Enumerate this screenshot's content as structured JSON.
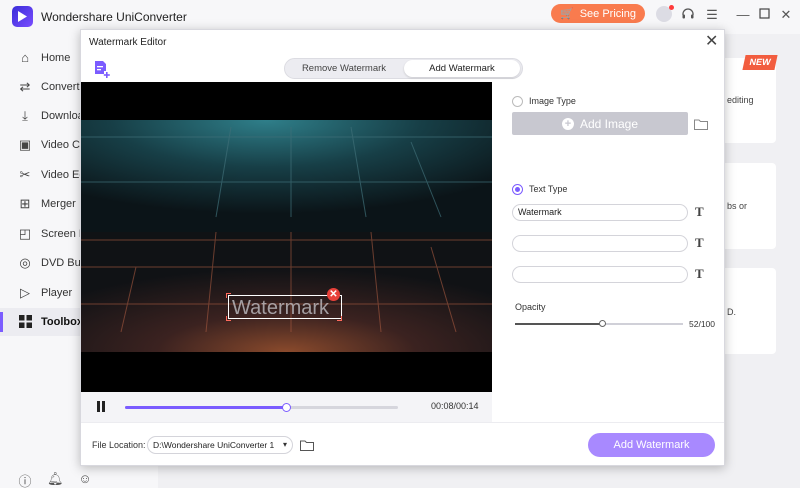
{
  "app": {
    "title": "Wondershare UniConverter",
    "see_pricing": "See Pricing",
    "icons": [
      "user-icon",
      "headset-icon",
      "menu-icon",
      "minimize-icon",
      "maximize-icon",
      "close-icon"
    ]
  },
  "sidebar": {
    "items": [
      {
        "label": "Home",
        "icon": "home-icon"
      },
      {
        "label": "Converter",
        "icon": "converter-icon"
      },
      {
        "label": "Downloader",
        "icon": "download-icon"
      },
      {
        "label": "Video Compressor",
        "icon": "compress-icon"
      },
      {
        "label": "Video Editor",
        "icon": "scissors-icon"
      },
      {
        "label": "Merger",
        "icon": "merge-icon"
      },
      {
        "label": "Screen Recorder",
        "icon": "record-icon"
      },
      {
        "label": "DVD Burner",
        "icon": "disc-icon"
      },
      {
        "label": "Player",
        "icon": "play-icon"
      },
      {
        "label": "Toolbox",
        "icon": "grid-icon",
        "active": true
      }
    ],
    "bottom_icons": [
      "help-icon",
      "bell-icon",
      "feedback-icon"
    ]
  },
  "background": {
    "new_badge": "NEW",
    "snippets": [
      "editing",
      "bs or",
      "D."
    ]
  },
  "modal": {
    "title": "Watermark Editor",
    "tabs": [
      {
        "label": "Remove Watermark",
        "active": false
      },
      {
        "label": "Add Watermark",
        "active": true
      }
    ],
    "preview": {
      "watermark_text": "Watermark",
      "time": "00:08/00:14",
      "progress": 0.59
    },
    "panel": {
      "image_type_label": "Image Type",
      "image_type_selected": false,
      "add_image_label": "Add Image",
      "text_type_label": "Text Type",
      "text_type_selected": true,
      "text_inputs": [
        "Watermark",
        "",
        ""
      ],
      "opacity_label": "Opacity",
      "opacity_value": 52,
      "opacity_text": "52/100"
    },
    "footer": {
      "file_location_label": "File Location:",
      "file_location_value": "D:\\Wondershare UniConverter 1",
      "add_watermark_button": "Add Watermark"
    }
  },
  "colors": {
    "accent": "#7b5cff",
    "pricing": "#f97b4e",
    "add_watermark": "#a889ff"
  }
}
